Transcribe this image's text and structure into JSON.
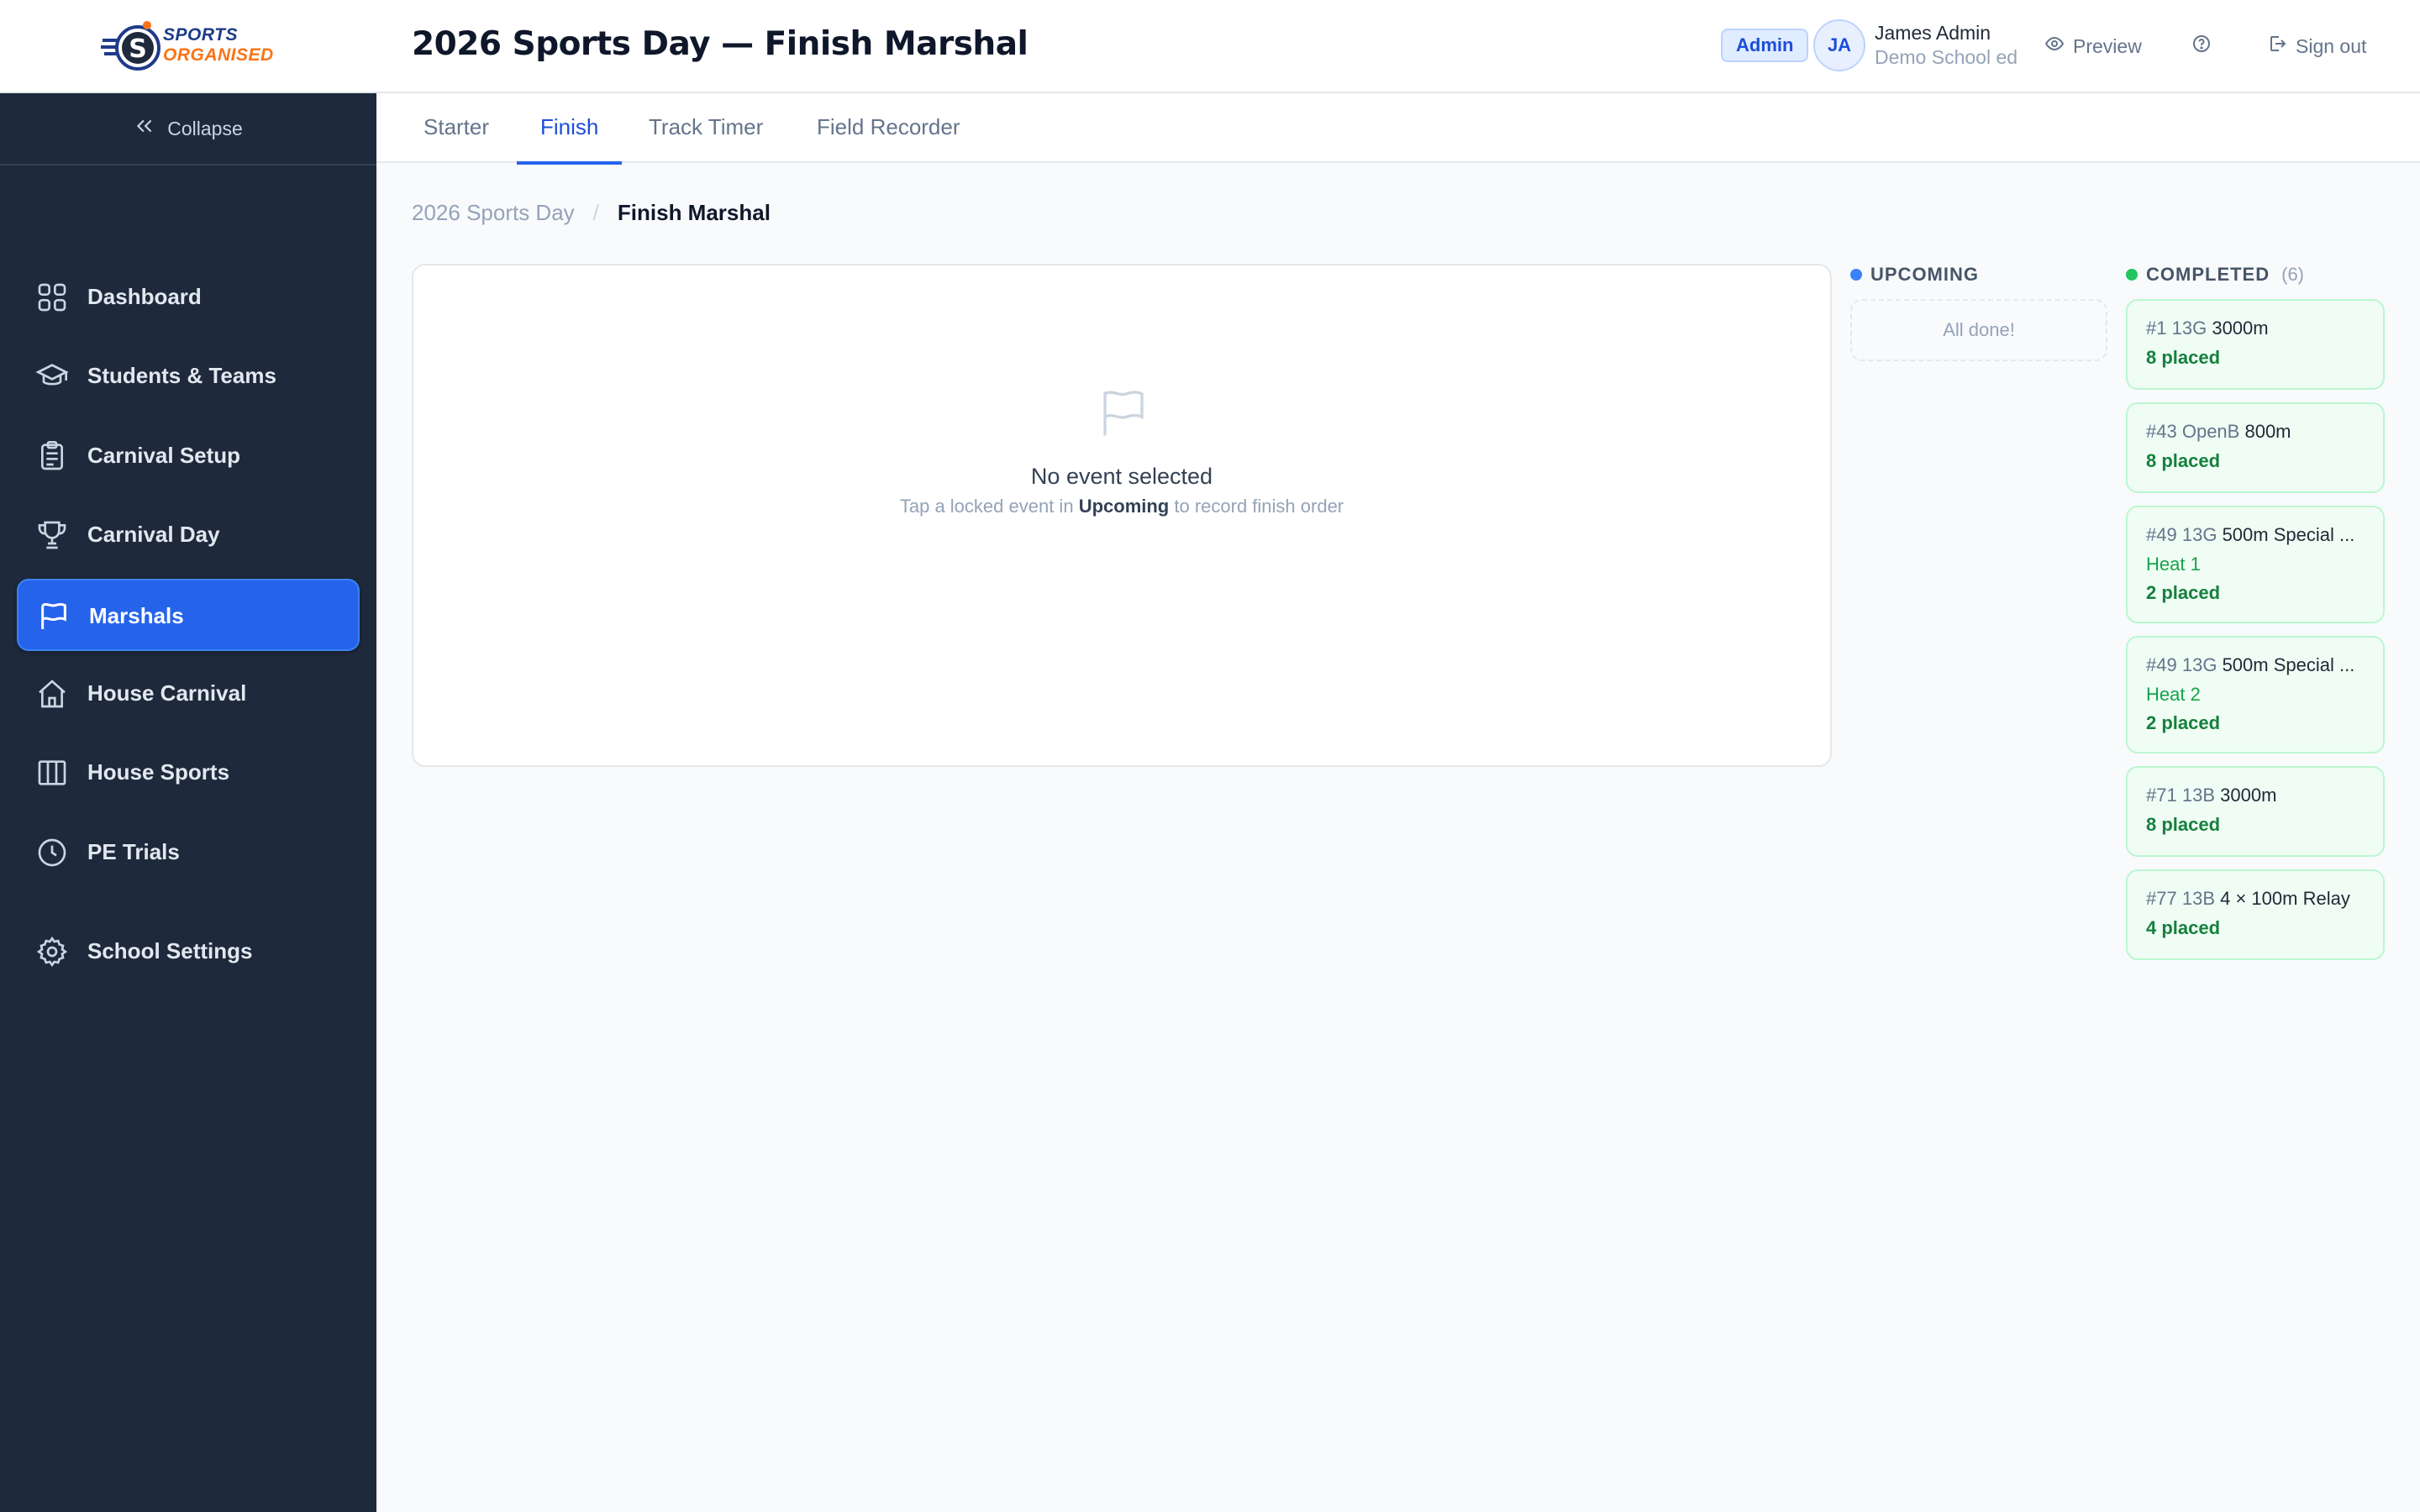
{
  "brand": {
    "line1": "SPORTS",
    "line2": "ORGANISED",
    "badge_letter": "S"
  },
  "header": {
    "title": "2026 Sports Day — Finish Marshal",
    "role_badge": "Admin",
    "user": {
      "initials": "JA",
      "name": "James Admin",
      "school": "Demo School ed"
    },
    "preview_label": "Preview",
    "help_icon": "help-circle-icon",
    "signout_label": "Sign out"
  },
  "sidebar": {
    "collapse_label": "Collapse",
    "items": [
      {
        "label": "Dashboard",
        "icon": "grid-icon"
      },
      {
        "label": "Students & Teams",
        "icon": "graduation-cap-icon"
      },
      {
        "label": "Carnival Setup",
        "icon": "clipboard-icon"
      },
      {
        "label": "Carnival Day",
        "icon": "trophy-icon"
      },
      {
        "label": "Marshals",
        "icon": "flag-icon",
        "active": true
      },
      {
        "label": "House Carnival",
        "icon": "house-icon"
      },
      {
        "label": "House Sports",
        "icon": "columns-icon"
      },
      {
        "label": "PE Trials",
        "icon": "clock-icon"
      },
      {
        "label": "School Settings",
        "icon": "gear-icon"
      }
    ]
  },
  "tabs": [
    {
      "label": "Starter"
    },
    {
      "label": "Finish",
      "active": true
    },
    {
      "label": "Track Timer"
    },
    {
      "label": "Field Recorder"
    }
  ],
  "breadcrumb": {
    "root": "2026 Sports Day",
    "separator": "/",
    "current": "Finish Marshal"
  },
  "empty_state": {
    "title": "No event selected",
    "subtitle_pre": "Tap a locked event in",
    "subtitle_bold": "Upcoming",
    "subtitle_post": "to record finish order"
  },
  "upcoming": {
    "heading": "UPCOMING",
    "empty_text": "All done!",
    "dot_color": "#3b82f6"
  },
  "completed": {
    "heading": "COMPLETED",
    "count": "(6)",
    "dot_color": "#22c55e",
    "events": [
      {
        "num": "#1",
        "group": "13G",
        "name": "3000m",
        "heat": "",
        "placed": "8 placed"
      },
      {
        "num": "#43",
        "group": "OpenB",
        "name": "800m",
        "heat": "",
        "placed": "8 placed"
      },
      {
        "num": "#49",
        "group": "13G",
        "name": "500m Special ...",
        "heat": "Heat 1",
        "placed": "2 placed"
      },
      {
        "num": "#49",
        "group": "13G",
        "name": "500m Special ...",
        "heat": "Heat 2",
        "placed": "2 placed"
      },
      {
        "num": "#71",
        "group": "13B",
        "name": "3000m",
        "heat": "",
        "placed": "8 placed"
      },
      {
        "num": "#77",
        "group": "13B",
        "name": "4 × 100m Relay",
        "heat": "",
        "placed": "4 placed"
      }
    ]
  },
  "colors": {
    "sidebar_bg": "#1e293b",
    "accent": "#2563eb",
    "success": "#16a34a"
  }
}
